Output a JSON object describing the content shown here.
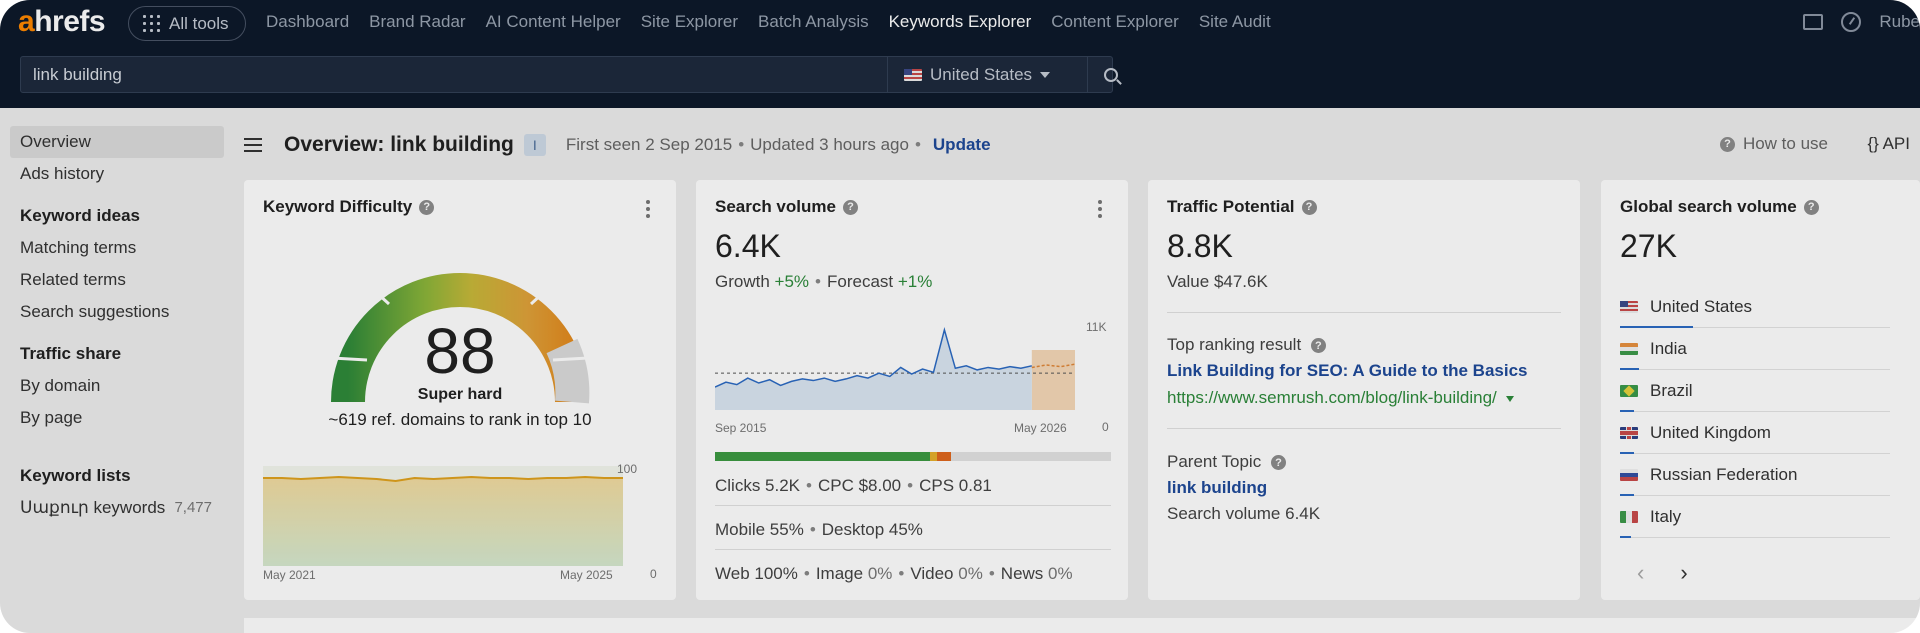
{
  "topbar": {
    "logo_prefix": "a",
    "logo_rest": "hrefs",
    "all_tools": "All tools",
    "nav": [
      {
        "label": "Dashboard",
        "active": false
      },
      {
        "label": "Brand Radar",
        "active": false
      },
      {
        "label": "AI Content Helper",
        "active": false
      },
      {
        "label": "Site Explorer",
        "active": false
      },
      {
        "label": "Batch Analysis",
        "active": false
      },
      {
        "label": "Keywords Explorer",
        "active": true
      },
      {
        "label": "Content Explorer",
        "active": false
      },
      {
        "label": "Site Audit",
        "active": false
      }
    ],
    "user_name": "Rube"
  },
  "search": {
    "value": "link building",
    "country": "United States"
  },
  "sidebar": {
    "overview": "Overview",
    "ads_history": "Ads history",
    "keyword_ideas_head": "Keyword ideas",
    "matching_terms": "Matching terms",
    "related_terms": "Related terms",
    "search_suggestions": "Search suggestions",
    "traffic_share_head": "Traffic share",
    "by_domain": "By domain",
    "by_page": "By page",
    "keyword_lists_head": "Keyword lists",
    "list_name": "Սաքուր keywords",
    "list_count": "7,477"
  },
  "header": {
    "title": "Overview: link building",
    "info_badge": "I",
    "first_seen": "First seen 2 Sep 2015",
    "updated": "Updated 3 hours ago",
    "update_link": "Update",
    "how_to_use": "How to use",
    "api": "{} API"
  },
  "kd_card": {
    "title": "Keyword Difficulty",
    "score": "88",
    "level": "Super hard",
    "description": "~619 ref. domains to rank in top 10",
    "chart_start": "May 2021",
    "chart_end": "May 2025",
    "y_max": "100",
    "y_min": "0"
  },
  "sv_card": {
    "title": "Search volume",
    "value": "6.4K",
    "growth_label": "Growth",
    "growth_value": "+5%",
    "forecast_label": "Forecast",
    "forecast_value": "+1%",
    "chart_start": "Sep 2015",
    "chart_end": "May 2026",
    "y_max": "11K",
    "y_min": "0",
    "clicks": "Clicks 5.2K",
    "cpc": "CPC $8.00",
    "cps": "CPS 0.81",
    "mobile": "Mobile 55%",
    "desktop": "Desktop 45%",
    "web_label": "Web",
    "web_value": "100%",
    "image_label": "Image",
    "image_value": "0%",
    "video_label": "Video",
    "video_value": "0%",
    "news_label": "News",
    "news_value": "0%"
  },
  "tp_card": {
    "title": "Traffic Potential",
    "value": "8.8K",
    "value_line": "Value $47.6K",
    "top_result_label": "Top ranking result",
    "top_result_title": "Link Building for SEO: A Guide to the Basics",
    "top_result_url": "https://www.semrush.com/blog/link-building/",
    "parent_topic_label": "Parent Topic",
    "parent_topic": "link building",
    "parent_volume": "Search volume 6.4K"
  },
  "gsv_card": {
    "title": "Global search volume",
    "value": "27K",
    "countries": [
      {
        "name": "United States",
        "flag": "us",
        "share": 0.27
      },
      {
        "name": "India",
        "flag": "in",
        "share": 0.07
      },
      {
        "name": "Brazil",
        "flag": "br",
        "share": 0.05
      },
      {
        "name": "United Kingdom",
        "flag": "uk",
        "share": 0.05
      },
      {
        "name": "Russian Federation",
        "flag": "ru",
        "share": 0.05
      },
      {
        "name": "Italy",
        "flag": "it",
        "share": 0.04
      }
    ]
  },
  "chart_data": [
    {
      "type": "area",
      "name": "Keyword Difficulty history",
      "x": [
        "May 2021",
        "May 2025"
      ],
      "values": [
        88,
        88,
        87,
        88,
        89,
        88,
        87,
        85,
        88,
        87,
        88,
        89,
        88,
        88,
        87,
        88,
        88,
        89,
        88,
        88
      ],
      "ylim": [
        0,
        100
      ]
    },
    {
      "type": "area",
      "name": "Search volume history",
      "x": [
        "Sep 2015",
        "May 2026"
      ],
      "values": [
        2800,
        3400,
        3100,
        3900,
        3300,
        3700,
        3000,
        3500,
        3800,
        3600,
        3900,
        3500,
        3800,
        4200,
        3900,
        4500,
        4100,
        5200,
        4400,
        5000,
        4600,
        9800,
        5100,
        5400,
        4900,
        5200,
        5000,
        5300,
        5100,
        5400
      ],
      "forecast_values": [
        5200,
        5500,
        5300,
        5600
      ],
      "ylim": [
        0,
        11000
      ]
    }
  ]
}
